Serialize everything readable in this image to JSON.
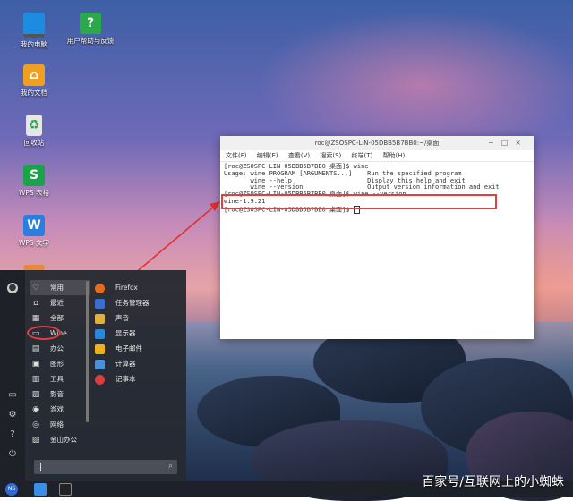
{
  "desktop_icons": [
    {
      "label": "我的电脑",
      "icon": "computer-icon",
      "color": "#1d8be0"
    },
    {
      "label": "用户帮助与反馈",
      "icon": "help-feedback-icon",
      "color": "#2aa84a"
    },
    {
      "label": "我的文档",
      "icon": "folder-icon",
      "color": "#f0a020"
    },
    {
      "label": "回收站",
      "icon": "recycle-bin-icon",
      "color": "#e6e6e6"
    },
    {
      "label": "WPS 表格",
      "icon": "wps-spreadsheet-icon",
      "color": "#1ba24a",
      "glyph": "S"
    },
    {
      "label": "WPS 文字",
      "icon": "wps-writer-icon",
      "color": "#2a7de1",
      "glyph": "W"
    }
  ],
  "terminal": {
    "title": "roc@ZSOSPC-LIN-05DBB5B7BB0:~/桌面",
    "menu": [
      "文件(F)",
      "编辑(E)",
      "查看(V)",
      "搜索(S)",
      "终端(T)",
      "帮助(H)"
    ],
    "lines": [
      "[roc@ZSOSPC-LIN-05DBB5B7BB0 桌面]$ wine",
      "Usage: wine PROGRAM [ARGUMENTS...]    Run the specified program",
      "       wine --help                    Display this help and exit",
      "       wine --version                 Output version information and exit",
      "[roc@ZSOSPC-LIN-05DBB5B7BB0 桌面]$ wine --version",
      "wine-1.9.21",
      "[roc@ZSOSPC-LIN-05DBB5B7BB0 桌面]$ "
    ]
  },
  "start_menu": {
    "categories": [
      {
        "label": "常用",
        "icon": "heart-icon",
        "glyph": "♡"
      },
      {
        "label": "最近",
        "icon": "home-icon",
        "glyph": "⌂"
      },
      {
        "label": "全部",
        "icon": "grid-icon",
        "glyph": "▦"
      },
      {
        "label": "Wine",
        "icon": "wine-monitor-icon",
        "glyph": "▭"
      },
      {
        "label": "办公",
        "icon": "briefcase-icon",
        "glyph": "▤"
      },
      {
        "label": "图形",
        "icon": "image-icon",
        "glyph": "▣"
      },
      {
        "label": "工具",
        "icon": "toolbox-icon",
        "glyph": "▥"
      },
      {
        "label": "影音",
        "icon": "film-icon",
        "glyph": "▧"
      },
      {
        "label": "游戏",
        "icon": "gamepad-icon",
        "glyph": "◉"
      },
      {
        "label": "网络",
        "icon": "globe-icon",
        "glyph": "◎"
      },
      {
        "label": "金山办公",
        "icon": "kingsoft-icon",
        "glyph": "▨"
      }
    ],
    "apps": [
      {
        "label": "Firefox",
        "icon": "firefox-icon",
        "color": "#e86a1a"
      },
      {
        "label": "任务管理器",
        "icon": "task-manager-icon",
        "color": "#3a6fd0"
      },
      {
        "label": "声音",
        "icon": "sound-icon",
        "color": "#e0b040"
      },
      {
        "label": "显示器",
        "icon": "display-icon",
        "color": "#2e86d8"
      },
      {
        "label": "电子邮件",
        "icon": "email-icon",
        "color": "#f2b01e"
      },
      {
        "label": "计算器",
        "icon": "calculator-icon",
        "color": "#4a90d9"
      },
      {
        "label": "记事本",
        "icon": "notepad-icon",
        "color": "#d84040"
      }
    ]
  },
  "taskbar": {
    "start_label": "NS",
    "items": [
      "file-manager-icon",
      "terminal-icon"
    ]
  },
  "watermark": "百家号/互联网上的小蜘蛛"
}
